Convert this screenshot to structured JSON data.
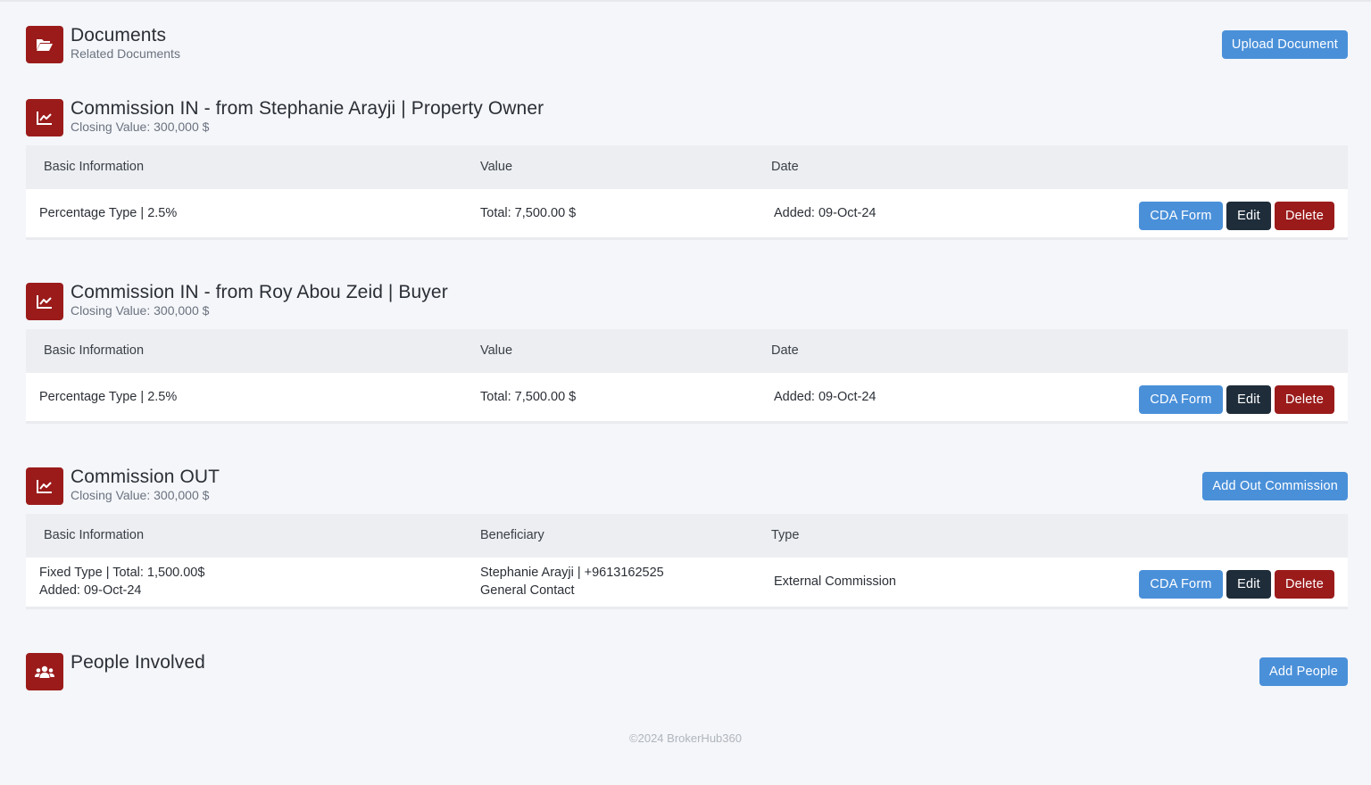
{
  "documents": {
    "title": "Documents",
    "subtitle": "Related Documents",
    "upload_label": "Upload Document"
  },
  "commission_in_1": {
    "title": "Commission IN - from Stephanie Arayji | Property Owner",
    "subtitle": "Closing Value: 300,000 $",
    "headers": [
      "Basic Information",
      "Value",
      "Date"
    ],
    "row": {
      "basic": "Percentage Type | 2.5%",
      "value": "Total: 7,500.00 $",
      "date": "Added: 09-Oct-24"
    }
  },
  "commission_in_2": {
    "title": "Commission IN - from Roy Abou Zeid | Buyer",
    "subtitle": "Closing Value: 300,000 $",
    "headers": [
      "Basic Information",
      "Value",
      "Date"
    ],
    "row": {
      "basic": "Percentage Type | 2.5%",
      "value": "Total: 7,500.00 $",
      "date": "Added: 09-Oct-24"
    }
  },
  "commission_out": {
    "title": "Commission OUT",
    "subtitle": "Closing Value: 300,000 $",
    "add_label": "Add Out Commission",
    "headers": [
      "Basic Information",
      "Beneficiary",
      "Type"
    ],
    "row": {
      "basic_line1": "Fixed Type | Total: 1,500.00$",
      "basic_line2": "Added: 09-Oct-24",
      "beneficiary_line1": "Stephanie Arayji | +9613162525",
      "beneficiary_line2": "General Contact",
      "type": "External Commission"
    }
  },
  "people": {
    "title": "People Involved",
    "add_label": "Add People"
  },
  "actions": {
    "cda_label": "CDA Form",
    "edit_label": "Edit",
    "delete_label": "Delete"
  },
  "footer": {
    "text": "©2024 BrokerHub360"
  },
  "colors": {
    "background": "#f4f6f9",
    "brand_red": "#9b1b1b",
    "primary_blue": "#4a90d9",
    "dark": "#1f2d3a",
    "table_header": "#eceef1"
  },
  "icons": {
    "documents": "folder-open-icon",
    "commission": "chart-line-icon",
    "people": "users-icon"
  }
}
